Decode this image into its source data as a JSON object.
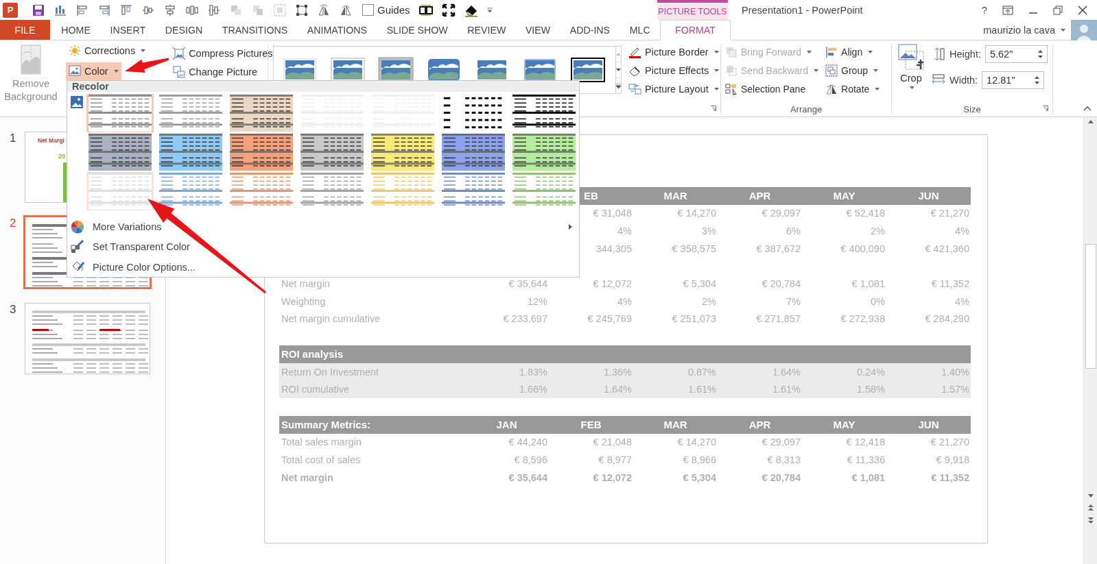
{
  "window": {
    "title": "Presentation1 - PowerPoint",
    "context_label": "PICTURE TOOLS",
    "help": "?",
    "user": "maurizio la cava"
  },
  "quick_access": {
    "logo": "P",
    "guides": {
      "label": "Guides",
      "checked": false
    }
  },
  "tabs": [
    {
      "label": "FILE",
      "kind": "file",
      "selected": false
    },
    {
      "label": "HOME",
      "kind": "tab",
      "selected": false
    },
    {
      "label": "INSERT",
      "kind": "tab",
      "selected": false
    },
    {
      "label": "DESIGN",
      "kind": "tab",
      "selected": false
    },
    {
      "label": "TRANSITIONS",
      "kind": "tab",
      "selected": false
    },
    {
      "label": "ANIMATIONS",
      "kind": "tab",
      "selected": false
    },
    {
      "label": "SLIDE SHOW",
      "kind": "tab",
      "selected": false
    },
    {
      "label": "REVIEW",
      "kind": "tab",
      "selected": false
    },
    {
      "label": "VIEW",
      "kind": "tab",
      "selected": false
    },
    {
      "label": "ADD-INS",
      "kind": "tab",
      "selected": false
    },
    {
      "label": "MLC",
      "kind": "tab",
      "selected": false
    },
    {
      "label": "FORMAT",
      "kind": "contextual",
      "selected": true
    }
  ],
  "ribbon": {
    "remove_background": {
      "label": "Remove Background",
      "disabled": true
    },
    "adjust": [
      {
        "label": "Corrections",
        "pressed": false,
        "dropdown": true
      },
      {
        "label": "Color",
        "pressed": true,
        "dropdown": true
      }
    ],
    "picture": [
      {
        "label": "Compress Pictures"
      },
      {
        "label": "Change Picture"
      }
    ],
    "styles": [
      {
        "kind": "simple"
      },
      {
        "kind": "white-frame"
      },
      {
        "kind": "gray-frame"
      },
      {
        "kind": "rounded"
      },
      {
        "kind": "reflected"
      },
      {
        "kind": "soft"
      },
      {
        "kind": "black-frame"
      }
    ],
    "format": [
      {
        "label": "Picture Border",
        "dropdown": true
      },
      {
        "label": "Picture Effects",
        "dropdown": true
      },
      {
        "label": "Picture Layout",
        "dropdown": true
      }
    ],
    "arrange": {
      "label": "Arrange",
      "buttons": [
        {
          "label": "Bring Forward",
          "disabled": true,
          "dropdown": true
        },
        {
          "label": "Send Backward",
          "disabled": true,
          "dropdown": true
        },
        {
          "label": "Selection Pane",
          "disabled": false,
          "dropdown": false
        },
        {
          "label": "Align",
          "disabled": false,
          "dropdown": true
        },
        {
          "label": "Group",
          "disabled": false,
          "dropdown": true
        },
        {
          "label": "Rotate",
          "disabled": false,
          "dropdown": true
        }
      ]
    },
    "size": {
      "label": "Size",
      "crop": "Crop",
      "height": {
        "label": "Height:",
        "value": "5.62\""
      },
      "width": {
        "label": "Width:",
        "value": "12.81\""
      }
    }
  },
  "color_menu": {
    "title": "Recolor",
    "rows": [
      {
        "swatches": [
          {
            "kind": "bands",
            "color": "#8c8c8c",
            "selected": true,
            "hover": false
          },
          {
            "kind": "bands",
            "color": "#9a9a9a",
            "selected": false,
            "hover": false
          },
          {
            "kind": "full",
            "color": "#ecd7c2",
            "selected": false,
            "hover": false
          },
          {
            "kind": "bands",
            "color": "#eeeeee",
            "selected": false,
            "hover": false
          },
          {
            "kind": "bands",
            "color": "#f0f0f0",
            "selected": false,
            "hover": false
          },
          {
            "kind": "dots",
            "color": "#000000",
            "selected": false,
            "hover": false
          },
          {
            "kind": "bands",
            "color": "#000000",
            "selected": false,
            "hover": false
          }
        ]
      },
      {
        "swatches": [
          {
            "kind": "full",
            "color": "#aab1c0",
            "selected": false,
            "hover": false
          },
          {
            "kind": "full",
            "color": "#8fcaf5",
            "selected": false,
            "hover": false
          },
          {
            "kind": "full",
            "color": "#f5a17b",
            "selected": false,
            "hover": false
          },
          {
            "kind": "full",
            "color": "#c9c9c9",
            "selected": false,
            "hover": false
          },
          {
            "kind": "full",
            "color": "#f7ea7b",
            "selected": false,
            "hover": false
          },
          {
            "kind": "full",
            "color": "#8ca2e9",
            "selected": false,
            "hover": false
          },
          {
            "kind": "full",
            "color": "#b6ec9d",
            "selected": false,
            "hover": false
          }
        ]
      },
      {
        "swatches": [
          {
            "kind": "bands",
            "color": "#dddddd",
            "selected": false,
            "hover": true
          },
          {
            "kind": "bands",
            "color": "#7ca4d0",
            "selected": false,
            "hover": false
          },
          {
            "kind": "bands",
            "color": "#e1946b",
            "selected": false,
            "hover": false
          },
          {
            "kind": "bands",
            "color": "#a1a1a1",
            "selected": false,
            "hover": false
          },
          {
            "kind": "bands",
            "color": "#e9c76b",
            "selected": false,
            "hover": false
          },
          {
            "kind": "bands",
            "color": "#6d87c5",
            "selected": false,
            "hover": false
          },
          {
            "kind": "bands",
            "color": "#90bd70",
            "selected": false,
            "hover": false
          }
        ]
      }
    ],
    "items": [
      {
        "label": "More Variations",
        "submenu": true
      },
      {
        "label": "Set Transparent Color",
        "submenu": false
      },
      {
        "label": "Picture Color Options...",
        "submenu": false
      }
    ]
  },
  "slides": [
    {
      "number": "1",
      "selected": false,
      "kind": "chart",
      "title": "Net Margi",
      "value": "20"
    },
    {
      "number": "2",
      "selected": true,
      "kind": "table-dark"
    },
    {
      "number": "3",
      "selected": false,
      "kind": "table-light"
    }
  ],
  "table": {
    "sections": [
      {
        "header": {
          "months": [
            "EB",
            "MAR",
            "APR",
            "MAY",
            "JUN"
          ]
        },
        "shaded": false,
        "rows": [
          {
            "total": false,
            "values": [
              "€ 31,048",
              "€ 14,270",
              "€ 29,097",
              "€ 52,418",
              "€ 21,270"
            ]
          },
          {
            "total": false,
            "values": [
              "4%",
              "3%",
              "6%",
              "2%",
              "4%"
            ]
          },
          {
            "total": false,
            "values": [
              "344,305",
              "€ 358,575",
              "€ 387,672",
              "€ 400,090",
              "€ 421,360"
            ]
          }
        ]
      },
      {
        "shaded": false,
        "rows": [
          {
            "label": "Net margin",
            "total": false,
            "values": [
              "€ 35,644",
              "€ 12,072",
              "€ 5,304",
              "€ 20,784",
              "€ 1,081",
              "€ 11,352"
            ]
          },
          {
            "label": "Weighting",
            "total": false,
            "values": [
              "12%",
              "4%",
              "2%",
              "7%",
              "0%",
              "4%"
            ]
          },
          {
            "label": "Net margin cumulative",
            "total": false,
            "values": [
              "€ 233,697",
              "€ 245,769",
              "€ 251,073",
              "€ 271,857",
              "€ 272,938",
              "€ 284,290"
            ]
          }
        ]
      },
      {
        "header": {
          "label": "ROI analysis"
        },
        "shaded": true,
        "rows": [
          {
            "label": "Return On Investment",
            "total": false,
            "values": [
              "1.83%",
              "1.36%",
              "0.87%",
              "1.64%",
              "0.24%",
              "1.40%"
            ]
          },
          {
            "label": "ROI cumulative",
            "total": false,
            "values": [
              "1.66%",
              "1.64%",
              "1.61%",
              "1.61%",
              "1.58%",
              "1.57%"
            ]
          }
        ]
      },
      {
        "header": {
          "label": "Summary Metrics:",
          "months": [
            "JAN",
            "FEB",
            "MAR",
            "APR",
            "MAY",
            "JUN"
          ]
        },
        "shaded": false,
        "rows": [
          {
            "label": "Total sales margin",
            "total": false,
            "values": [
              "€ 44,240",
              "€ 21,048",
              "€ 14,270",
              "€ 29,097",
              "€ 12,418",
              "€ 21,270"
            ]
          },
          {
            "label": "Total cost of sales",
            "total": false,
            "values": [
              "€ 8,596",
              "€ 8,977",
              "€ 8,966",
              "€ 8,313",
              "€ 11,336",
              "€ 9,918"
            ]
          },
          {
            "label": "Net margin",
            "total": true,
            "values": [
              "€ 35,644",
              "€ 12,072",
              "€ 5,304",
              "€ 20,784",
              "€ 1,081",
              "€ 11,352"
            ]
          }
        ]
      }
    ]
  }
}
